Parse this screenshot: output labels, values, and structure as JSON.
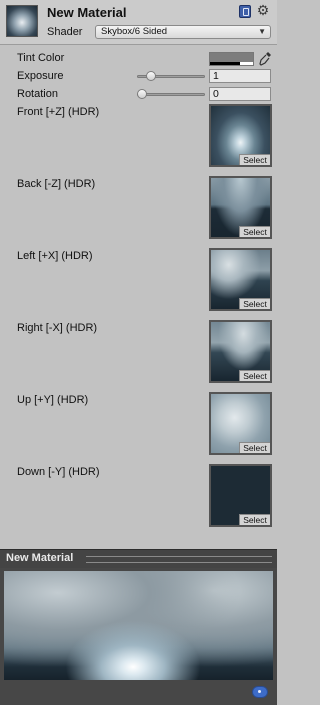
{
  "material": {
    "name": "New Material"
  },
  "shader": {
    "label": "Shader",
    "value": "Skybox/6 Sided"
  },
  "properties": {
    "tint": {
      "label": "Tint Color",
      "color": "#7d7d7d"
    },
    "exposure": {
      "label": "Exposure",
      "value": "1",
      "slider_fraction": 0.16
    },
    "rotation": {
      "label": "Rotation",
      "value": "0",
      "slider_fraction": 0.0
    }
  },
  "textures": [
    {
      "label": "Front [+Z]   (HDR)",
      "select_label": "Select"
    },
    {
      "label": "Back [-Z]   (HDR)",
      "select_label": "Select"
    },
    {
      "label": "Left [+X]   (HDR)",
      "select_label": "Select"
    },
    {
      "label": "Right [-X]   (HDR)",
      "select_label": "Select"
    },
    {
      "label": "Up [+Y]   (HDR)",
      "select_label": "Select"
    },
    {
      "label": "Down [-Y]   (HDR)",
      "select_label": "Select"
    }
  ],
  "preview": {
    "title": "New Material"
  },
  "icons": {
    "help": "help-book-icon",
    "settings": "gear-icon",
    "eyedropper": "eyedropper-icon",
    "asset_label": "asset-label-tag-icon"
  }
}
